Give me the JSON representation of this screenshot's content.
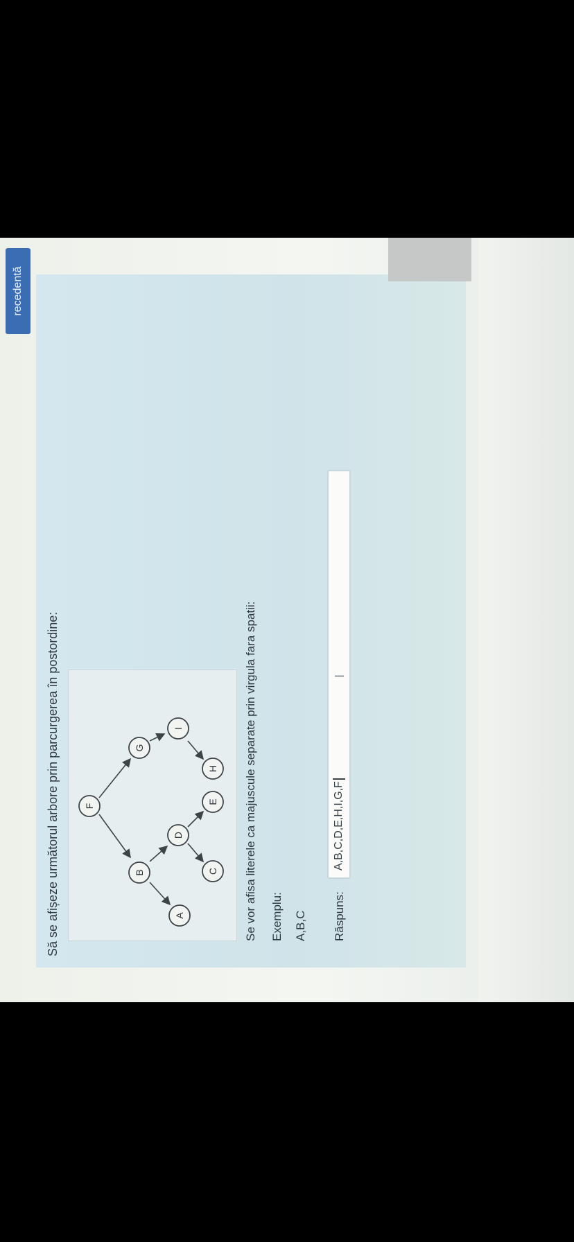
{
  "question": {
    "title": "Să se afișeze următorul arbore prin parcurgerea în postordine:",
    "instruction": "Se vor afisa literele ca majuscule separate prin virgula fara spatii:",
    "example_label": "Exemplu:",
    "example_value": "A,B,C",
    "answer_label": "Răspuns:",
    "answer_value": "A,B,C,D,E,H,I,G,F"
  },
  "tree": {
    "nodes": [
      "F",
      "B",
      "G",
      "A",
      "D",
      "I",
      "C",
      "E",
      "H"
    ]
  },
  "nav": {
    "prev_label": "recedentă"
  },
  "colors": {
    "panel": "#d4e7ef",
    "button": "#3a6db1",
    "node_fill": "#f2f4f2",
    "edge": "#3c4448"
  }
}
